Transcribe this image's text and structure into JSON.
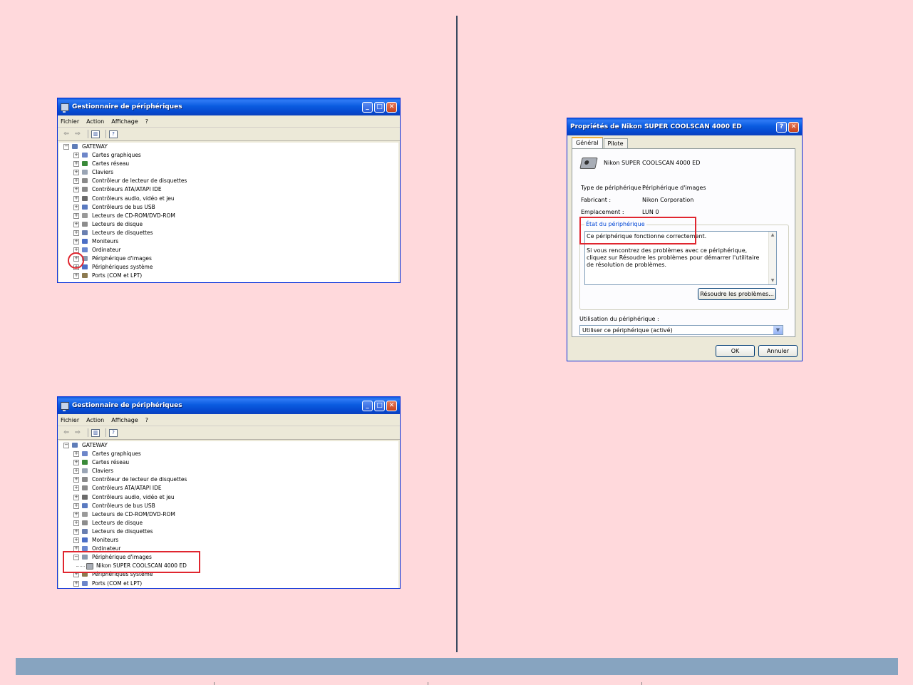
{
  "device_manager": {
    "title": "Gestionnaire de périphériques",
    "menu": [
      "Fichier",
      "Action",
      "Affichage",
      "?"
    ],
    "window_controls": {
      "minimize": "_",
      "maximize": "□",
      "close": "✕"
    },
    "root": "GATEWAY",
    "items_window1": [
      "Cartes graphiques",
      "Cartes réseau",
      "Claviers",
      "Contrôleur de lecteur de disquettes",
      "Contrôleurs ATA/ATAPI IDE",
      "Contrôleurs audio, vidéo et jeu",
      "Contrôleurs de bus USB",
      "Lecteurs de CD-ROM/DVD-ROM",
      "Lecteurs de disque",
      "Lecteurs de disquettes",
      "Moniteurs",
      "Ordinateur",
      "Périphérique d'images",
      "Périphériques système",
      "Ports (COM et LPT)"
    ],
    "items_window2": [
      "Cartes graphiques",
      "Cartes réseau",
      "Claviers",
      "Contrôleur de lecteur de disquettes",
      "Contrôleurs ATA/ATAPI IDE",
      "Contrôleurs audio, vidéo et jeu",
      "Contrôleurs de bus USB",
      "Lecteurs de CD-ROM/DVD-ROM",
      "Lecteurs de disque",
      "Lecteurs de disquettes",
      "Moniteurs",
      "Ordinateur",
      "Périphérique d'images",
      "Nikon SUPER COOLSCAN 4000 ED",
      "Périphériques système",
      "Ports (COM et LPT)"
    ]
  },
  "properties": {
    "title": "Propriétés de Nikon SUPER COOLSCAN 4000 ED",
    "help_button": "?",
    "close_button": "✕",
    "tabs": [
      "Général",
      "Pilote"
    ],
    "device_name": "Nikon SUPER COOLSCAN 4000 ED",
    "type_label": "Type de périphérique :",
    "type_value": "Périphérique d'images",
    "maker_label": "Fabricant :",
    "maker_value": "Nikon Corporation",
    "location_label": "Emplacement :",
    "location_value": "LUN 0",
    "status_group": "État du périphérique",
    "status_line": "Ce périphérique fonctionne correctement.",
    "status_help": "Si vous rencontrez des problèmes avec ce périphérique, cliquez sur Résoudre les problèmes pour démarrer l'utilitaire de résolution de problèmes.",
    "troubleshoot_button": "Résoudre les problèmes...",
    "usage_label": "Utilisation du périphérique :",
    "usage_value": "Utiliser ce périphérique (activé)",
    "ok_button": "OK",
    "cancel_button": "Annuler"
  },
  "colors": {
    "page_background": "#ffd9dc",
    "highlight_red": "#e0262f",
    "footer_bar": "#87a4c0",
    "divider": "#3a4a60"
  }
}
